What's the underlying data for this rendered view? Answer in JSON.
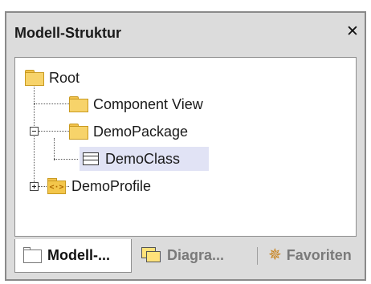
{
  "panel": {
    "title": "Modell-Struktur",
    "close_symbol": "✕"
  },
  "tree": {
    "root": "Root",
    "component_view": "Component View",
    "demo_package": "DemoPackage",
    "demo_class": "DemoClass",
    "demo_profile": "DemoProfile",
    "profile_icon_text": "<·>"
  },
  "tabs": {
    "modell_label": "Modell-...",
    "diagramm_label": "Diagra...",
    "favoriten_label": "Favoriten"
  },
  "icons": {
    "folder": "folder-icon",
    "class": "class-icon",
    "profile": "profile-folder-icon",
    "diagram": "diagram-icon",
    "favorites": "star-icon"
  },
  "colors": {
    "selection": "#e1e3f5",
    "folder_yellow": "#f7d36a",
    "panel_bg": "#dcdcdc"
  }
}
